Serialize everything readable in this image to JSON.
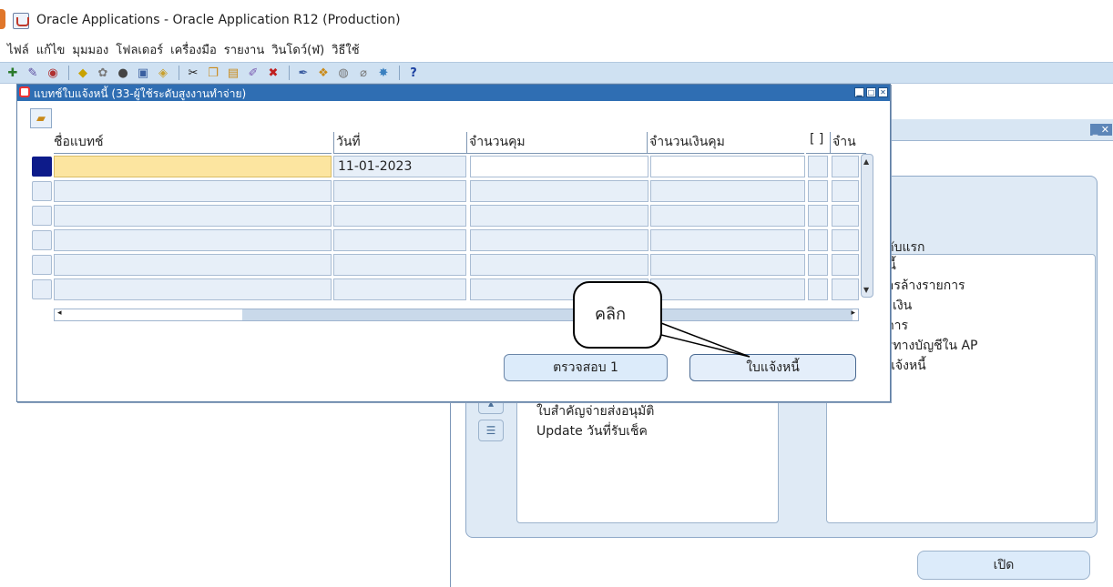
{
  "app": {
    "title": "Oracle Applications - Oracle Application R12 (Production)"
  },
  "menu": [
    "ไฟล์",
    "แก้ไข",
    "มุมมอง",
    "โฟลเดอร์",
    "เครื่องมือ",
    "รายงาน",
    "วินโดว์(ฬ)",
    "วิธีใช้"
  ],
  "toolbar": {
    "icons": [
      "new-record-icon",
      "find-icon",
      "navigator-icon",
      "save-icon",
      "next-step-icon",
      "switch-responsibility-icon",
      "print-icon",
      "close-form-icon",
      "cut-icon",
      "copy-icon",
      "paste-icon",
      "clear-record-icon",
      "delete-record-icon",
      "edit-field-icon",
      "zoom-icon",
      "translations-icon",
      "attachments-icon",
      "folder-tools-icon",
      "help-icon"
    ],
    "help_label": "?"
  },
  "batch_window": {
    "title": "แบทช์ใบแจ้งหนี้ (33-ผู้ใช้ระดับสูงงานทำจ่าย)",
    "columns": {
      "name": "ชื่อแบทช์",
      "date": "วันที่",
      "count": "จำนวนคุม",
      "amount": "จำนวนเงินคุม",
      "bracket": "[ ]",
      "last": "จำน"
    },
    "rows": [
      {
        "name": "",
        "date": "11-01-2023",
        "count": "",
        "amount": "",
        "active": true
      },
      {
        "name": "",
        "date": "",
        "count": "",
        "amount": "",
        "active": false
      },
      {
        "name": "",
        "date": "",
        "count": "",
        "amount": "",
        "active": false
      },
      {
        "name": "",
        "date": "",
        "count": "",
        "amount": "",
        "active": false
      },
      {
        "name": "",
        "date": "",
        "count": "",
        "amount": "",
        "active": false
      },
      {
        "name": "",
        "date": "",
        "count": "",
        "amount": "",
        "active": false
      }
    ],
    "buttons": {
      "verify": "ตรวจสอบ 1",
      "invoice": "ใบแจ้งหนี้"
    }
  },
  "callout": {
    "text": "คลิก"
  },
  "navigator": {
    "right_title": "ะดับแรก",
    "right_items": [
      "หนี้",
      "การล้างรายการ",
      "ระเงิน",
      "ยการ",
      "ารทางบัญชีใน AP",
      "บแจ้งหนี้"
    ],
    "left_items": [
      "ใบสำคัญจ่ายส่งอนุมัติ",
      "Update วันที่รับเช็ค"
    ],
    "open_button": "เปิด"
  }
}
